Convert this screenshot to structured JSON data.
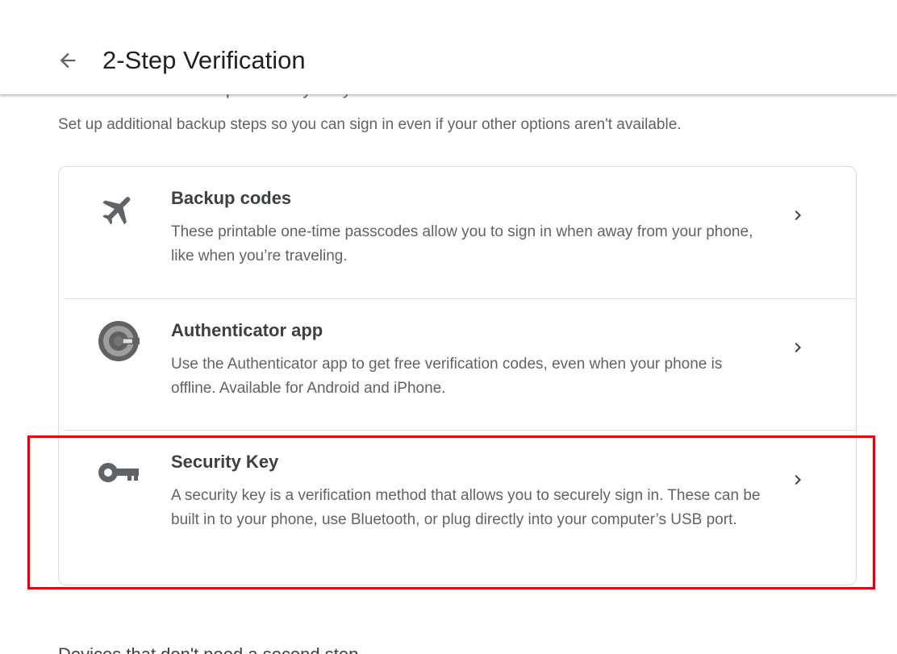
{
  "header": {
    "title": "2-Step Verification",
    "back_icon": "arrow-left-icon"
  },
  "section": {
    "heading": "Add more second steps to verify it's you",
    "description": "Set up additional backup steps so you can sign in even if your other options aren't available."
  },
  "options": [
    {
      "icon": "airplane-icon",
      "title": "Backup codes",
      "description": "These printable one-time passcodes allow you to sign in when away from your phone, like when you’re traveling."
    },
    {
      "icon": "authenticator-app-icon",
      "title": "Authenticator app",
      "description": "Use the Authenticator app to get free verification codes, even when your phone is offline. Available for Android and iPhone."
    },
    {
      "icon": "key-icon",
      "title": "Security Key",
      "description": "A security key is a verification method that allows you to securely sign in. These can be built in to your phone, use Bluetooth, or plug directly into your computer’s USB port."
    }
  ],
  "next_section": {
    "heading": "Devices that don't need a second step"
  },
  "colors": {
    "highlight": "#e1000f",
    "icon": "#5f6368",
    "divider": "#dadce0"
  }
}
